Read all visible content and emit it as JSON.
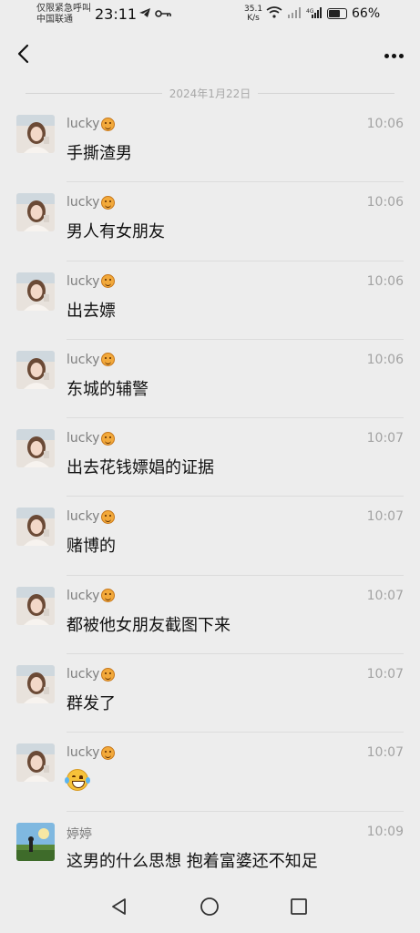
{
  "status_bar": {
    "carrier_line1": "仅限紧急呼叫",
    "carrier_line2": "中国联通",
    "time": "23:11",
    "net_speed_value": "35.1",
    "net_speed_unit": "K/s",
    "battery": "66%",
    "battery_level": 0.66
  },
  "chat": {
    "date_separator": "2024年1月22日",
    "messages": [
      {
        "sender": "lucky",
        "time": "10:06",
        "text": "手撕渣男"
      },
      {
        "sender": "lucky",
        "time": "10:06",
        "text": "男人有女朋友"
      },
      {
        "sender": "lucky",
        "time": "10:06",
        "text": "出去嫖"
      },
      {
        "sender": "lucky",
        "time": "10:06",
        "text": "东城的辅警"
      },
      {
        "sender": "lucky",
        "time": "10:07",
        "text": "出去花钱嫖娼的证据"
      },
      {
        "sender": "lucky",
        "time": "10:07",
        "text": "赌博的"
      },
      {
        "sender": "lucky",
        "time": "10:07",
        "text": "都被他女朋友截图下来"
      },
      {
        "sender": "lucky",
        "time": "10:07",
        "text": "群发了"
      },
      {
        "sender": "lucky",
        "time": "10:07",
        "text": ""
      },
      {
        "sender": "婷婷",
        "time": "10:09",
        "text": "这男的什么思想 抱着富婆还不知足"
      }
    ]
  },
  "icons": {
    "back": "chevron-left-icon",
    "more": "more-dots-icon",
    "sender_emoji": "smiling-face-emoji",
    "laugh_emoji": "tears-of-joy-emoji",
    "nav_back": "triangle-back-icon",
    "nav_home": "circle-home-icon",
    "nav_recent": "square-recent-icon"
  }
}
